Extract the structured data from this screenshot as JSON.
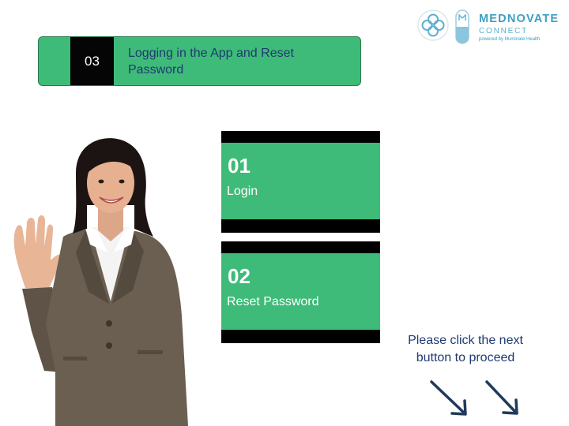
{
  "logo": {
    "name": "MEDNOVATE",
    "sub": "CONNECT",
    "tagline": "powered by Illuminate Health"
  },
  "header": {
    "number": "03",
    "title": "Logging in the App and Reset Password"
  },
  "menu": [
    {
      "number": "01",
      "label": "Login"
    },
    {
      "number": "02",
      "label": "Reset Password"
    }
  ],
  "instruction": "Please click the next button to proceed",
  "colors": {
    "accent_green": "#3ebb78",
    "dark_blue": "#1f3a72",
    "black": "#000000"
  },
  "icons": {
    "logo_mark": "clover-cross-icon",
    "capsule": "capsule-icon",
    "arrow": "arrow-down-right-icon"
  }
}
